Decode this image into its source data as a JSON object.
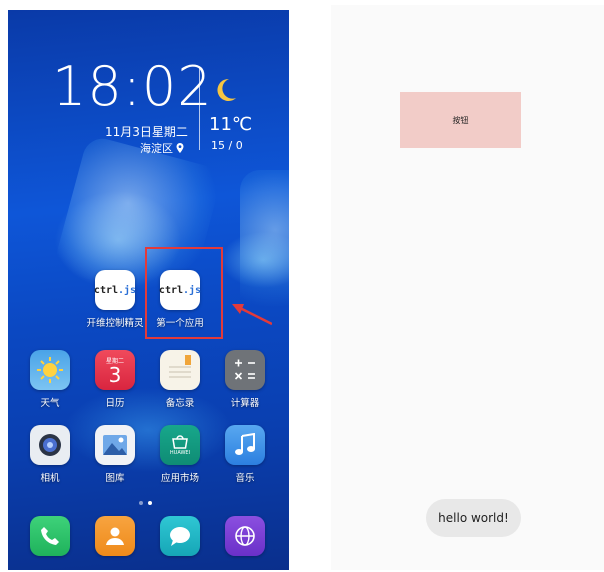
{
  "lockscreen": {
    "time": "18:02",
    "date": "11月3日星期二",
    "location": "海淀区",
    "temperature": "11℃",
    "temp_range": "15 / 0",
    "weather_icon": "moon-icon"
  },
  "apps_row1": [
    {
      "label": "开维控制精灵",
      "icon_text_a": "ctrl",
      "icon_text_b": ".js",
      "icon": "ctrljs-icon"
    },
    {
      "label": "第一个应用",
      "icon_text_a": "ctrl",
      "icon_text_b": ".js",
      "icon": "ctrljs-icon"
    }
  ],
  "apps_row2": [
    {
      "label": "天气",
      "icon": "weather-sun-icon"
    },
    {
      "label": "日历",
      "icon": "calendar-icon",
      "day_label": "星期二",
      "day_number": "3"
    },
    {
      "label": "备忘录",
      "icon": "notepad-icon"
    },
    {
      "label": "计算器",
      "icon": "calculator-icon"
    }
  ],
  "apps_row3": [
    {
      "label": "相机",
      "icon": "camera-icon"
    },
    {
      "label": "图库",
      "icon": "gallery-icon"
    },
    {
      "label": "应用市场",
      "icon": "appgallery-icon",
      "brand": "HUAWEI"
    },
    {
      "label": "音乐",
      "icon": "music-icon"
    }
  ],
  "dock": [
    {
      "icon": "phone-icon"
    },
    {
      "icon": "contacts-icon"
    },
    {
      "icon": "messages-icon"
    },
    {
      "icon": "browser-icon"
    }
  ],
  "app_screen": {
    "button_label": "按钮",
    "toast_text": "hello world!"
  },
  "colors": {
    "highlight": "#e33a3a",
    "button_bg": "#f2ccc8",
    "toast_bg": "#e8e8e8"
  }
}
